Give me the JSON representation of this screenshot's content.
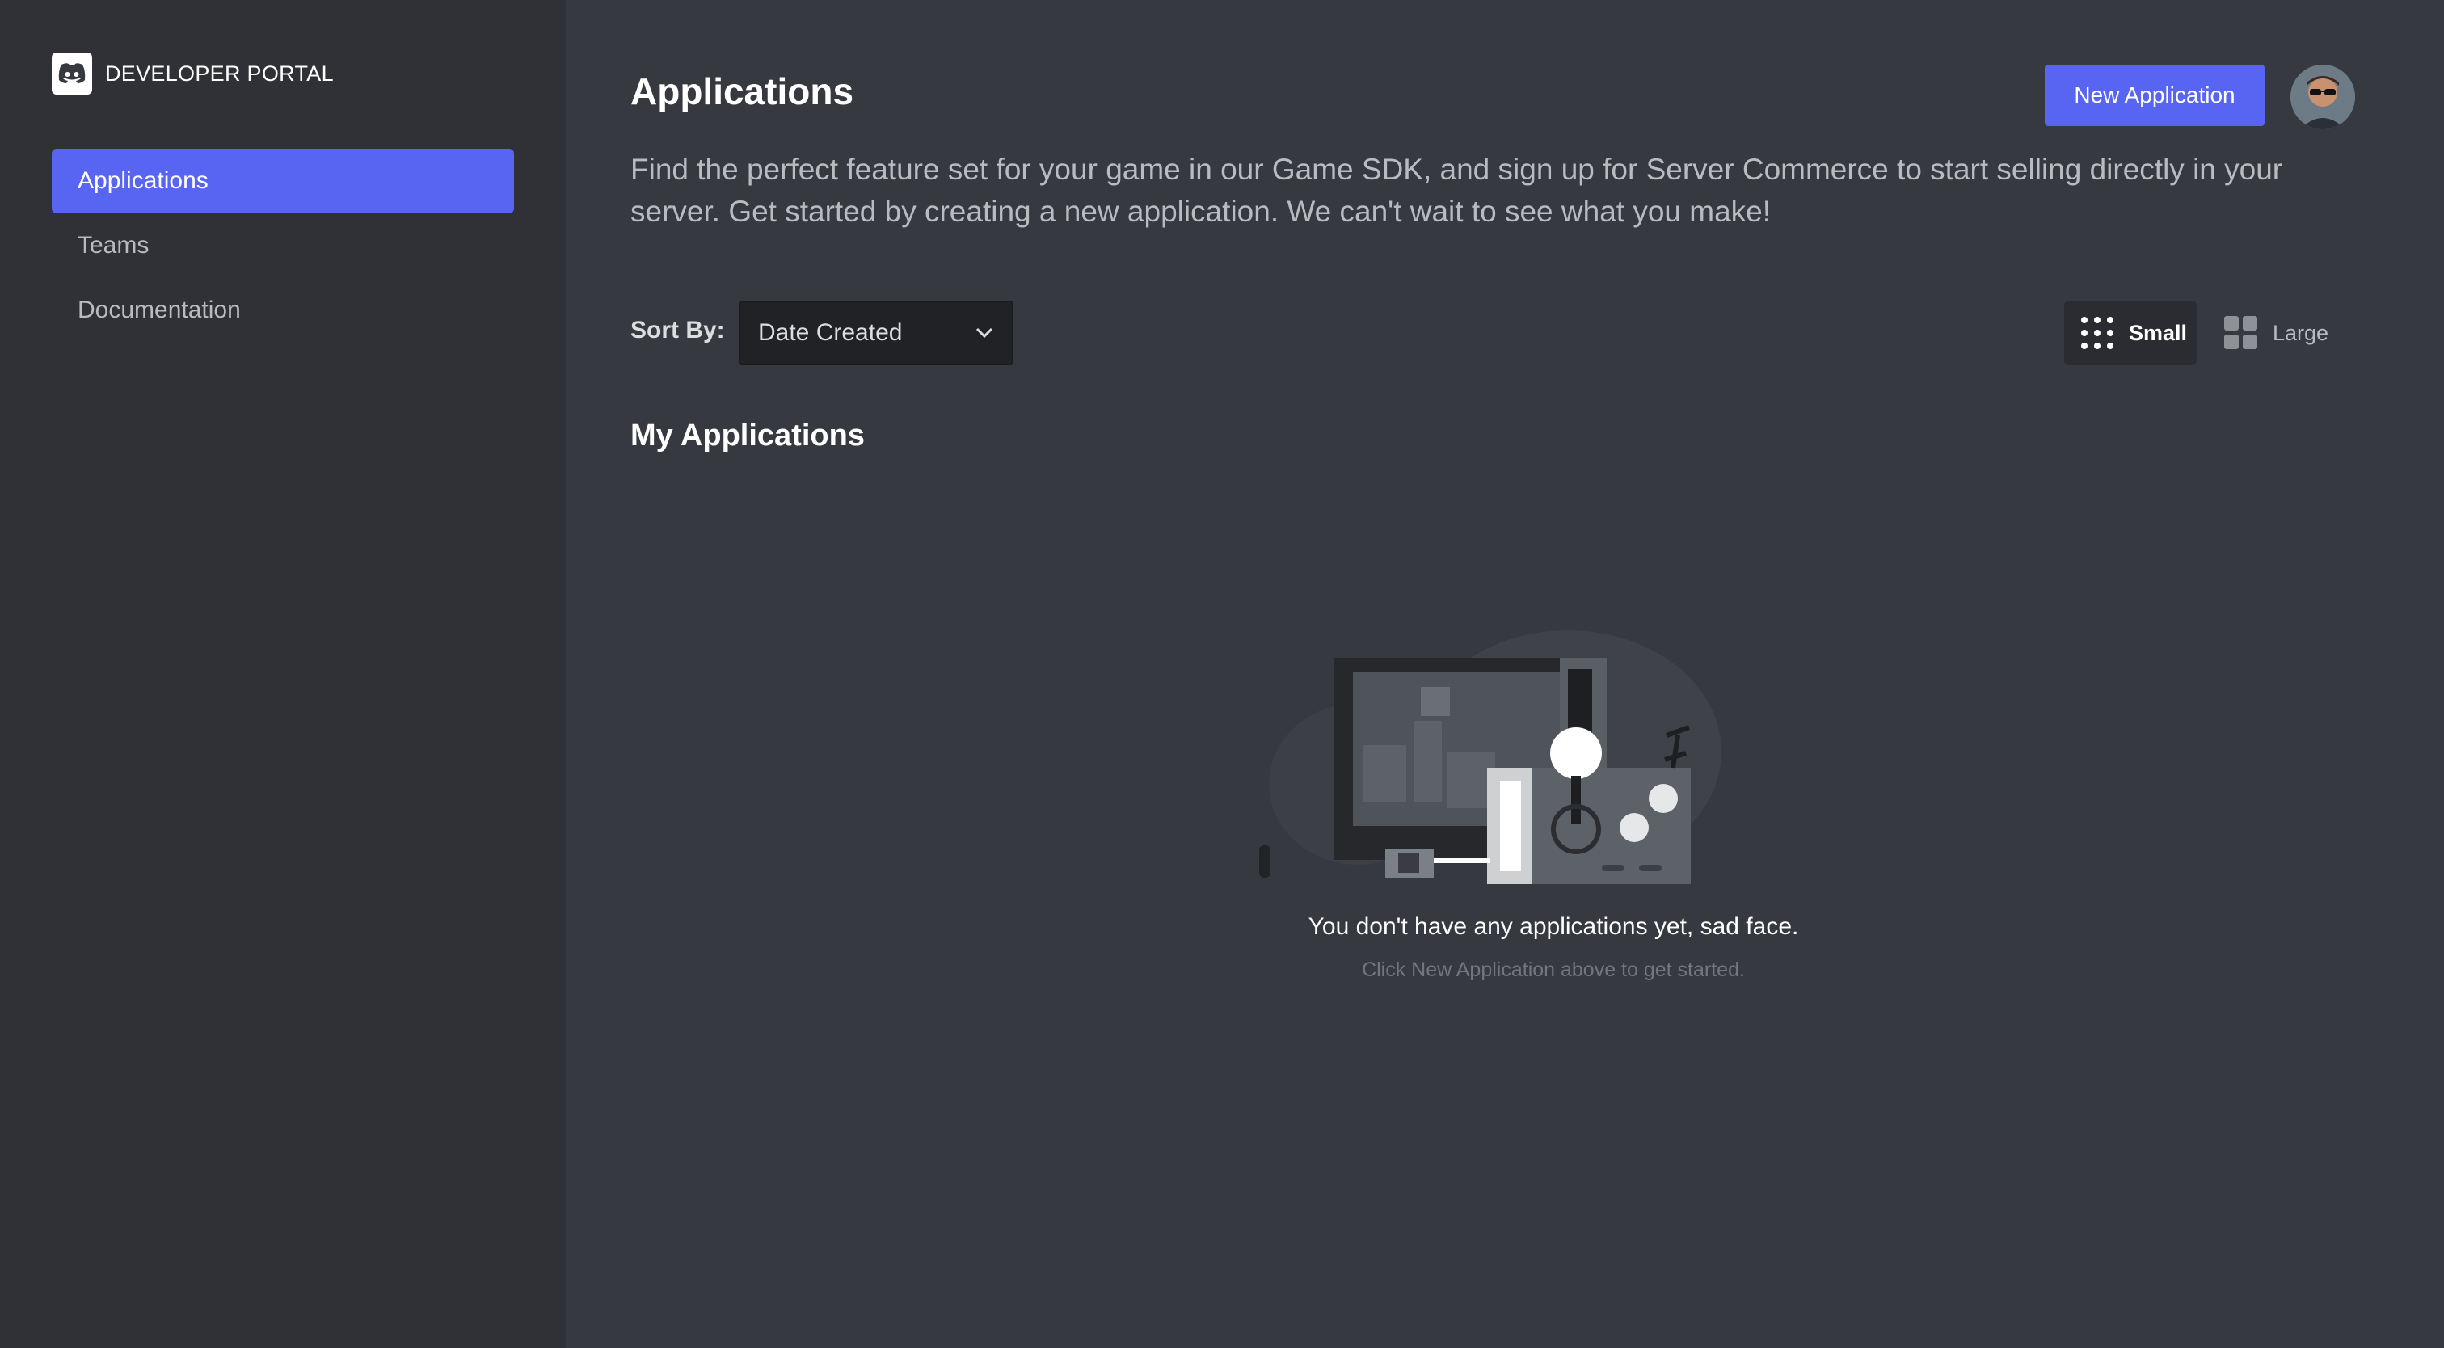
{
  "brand": {
    "title": "DEVELOPER PORTAL"
  },
  "sidebar": {
    "items": [
      {
        "label": "Applications",
        "active": true
      },
      {
        "label": "Teams",
        "active": false
      },
      {
        "label": "Documentation",
        "active": false
      }
    ]
  },
  "header": {
    "title": "Applications",
    "new_button": "New Application",
    "description": "Find the perfect feature set for your game in our Game SDK, and sign up for Server Commerce to start selling directly in your server. Get started by creating a new application. We can't wait to see what you make!"
  },
  "sort": {
    "label": "Sort By:",
    "selected": "Date Created"
  },
  "view_toggle": {
    "small": "Small",
    "large": "Large",
    "active": "small"
  },
  "section": {
    "title": "My Applications"
  },
  "empty_state": {
    "title": "You don't have any applications yet, sad face.",
    "subtitle": "Click New Application above to get started."
  },
  "colors": {
    "accent": "#5865f2",
    "sidebar_bg": "#2f3136",
    "main_bg": "#36393f"
  },
  "icons": {
    "logo": "discord-logo-icon",
    "dropdown": "chevron-down-icon",
    "small_grid": "dots-grid-icon",
    "large_grid": "squares-grid-icon"
  }
}
